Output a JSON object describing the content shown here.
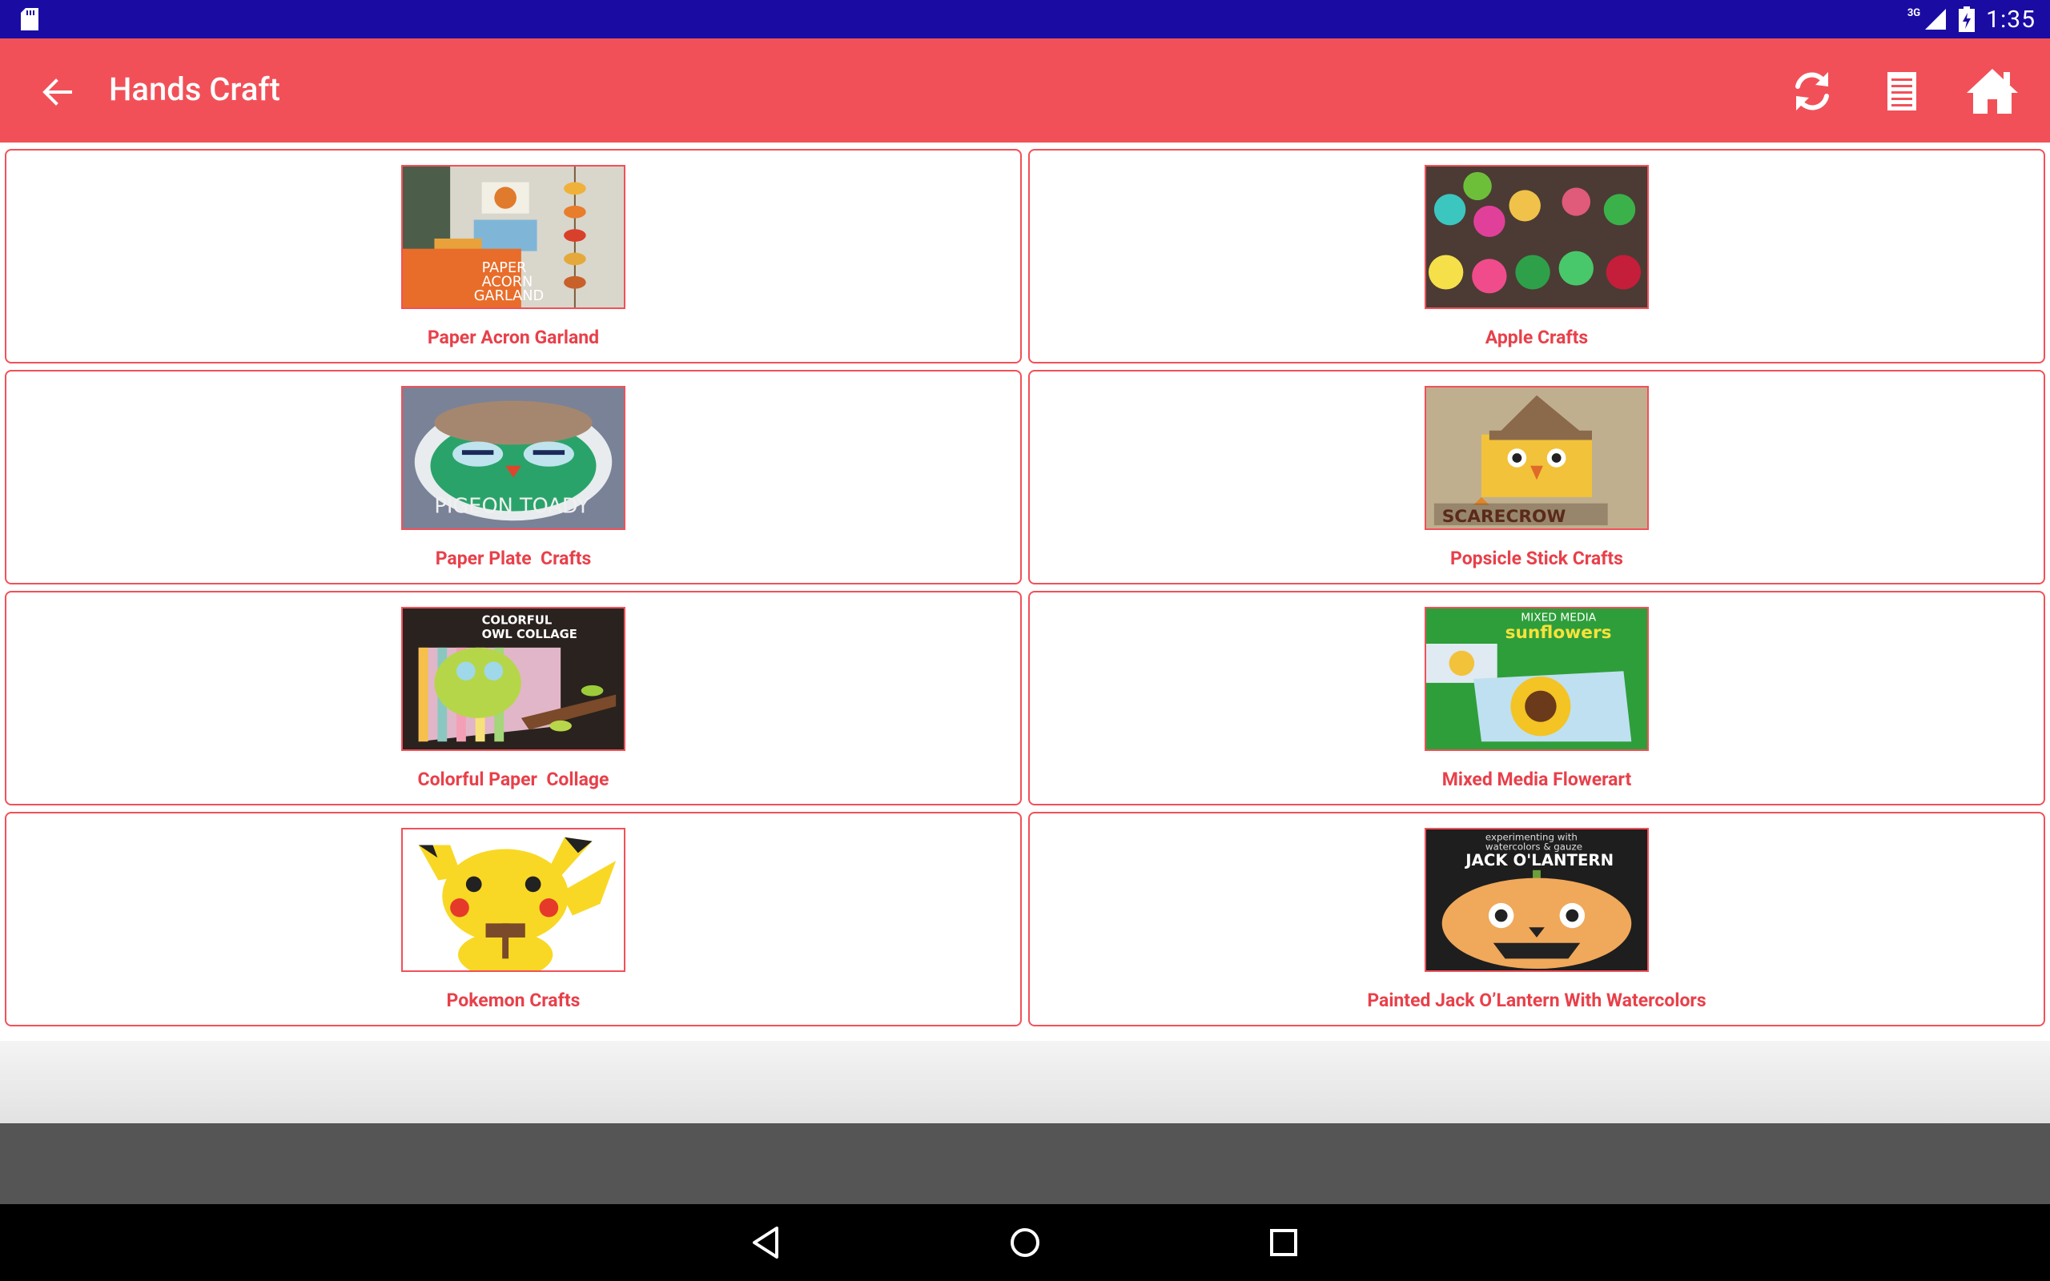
{
  "status_bar": {
    "network": "3G",
    "time": "1:35"
  },
  "app_bar": {
    "title": "Hands Craft",
    "icons": [
      "back-arrow-icon",
      "refresh-icon",
      "notes-icon",
      "home-icon"
    ]
  },
  "crafts": [
    {
      "label": "Paper Acron Garland",
      "image_text": [
        "PAPER",
        "ACORN",
        "GARLAND"
      ]
    },
    {
      "label": "Apple Crafts"
    },
    {
      "label": "Paper Plate  Crafts",
      "image_text": [
        "PIGEON TOADY"
      ]
    },
    {
      "label": "Popsicle Stick Crafts",
      "image_text": [
        "SCARECROW"
      ]
    },
    {
      "label": "Colorful Paper  Collage",
      "image_text": [
        "COLORFUL",
        "OWL COLLAGE"
      ]
    },
    {
      "label": "Mixed Media Flowerart",
      "image_text": [
        "MIXED MEDIA",
        "sunflowers"
      ]
    },
    {
      "label": "Pokemon Crafts"
    },
    {
      "label": "Painted Jack O’Lantern With Watercolors",
      "image_text": [
        "experimenting with",
        "watercolors & gauze",
        "JACK O'LANTERN"
      ]
    }
  ],
  "colors": {
    "status_bar": "#1a0ca3",
    "app_bar": "#f25058",
    "card_label": "#e8404a",
    "card_border": "#f25058",
    "ad_bar": "#555555",
    "nav_bar": "#000000"
  }
}
